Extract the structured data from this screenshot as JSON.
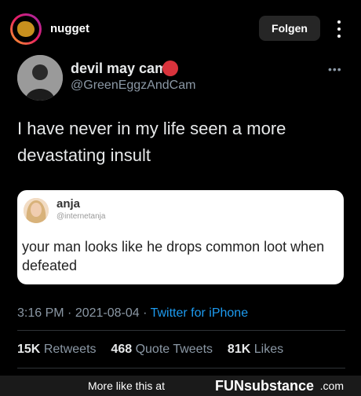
{
  "instagram": {
    "username": "nugget",
    "follow_label": "Folgen",
    "more_icon": "more-vertical-icon"
  },
  "tweet": {
    "display_name": "devil may cam",
    "name_emoji": "ogre-emoji",
    "handle": "@GreenEggzAndCam",
    "more_icon": "more-horizontal-icon",
    "text": "I have never in my life seen a more devastating insult",
    "quoted": {
      "name": "anja",
      "handle": "@internetanja",
      "text": "your man looks like he drops common loot when defeated"
    },
    "time": "3:16 PM",
    "date": "2021-08-04",
    "source": "Twitter for iPhone",
    "stats": {
      "retweets_count": "15K",
      "retweets_label": "Retweets",
      "quote_count": "468",
      "quote_label": "Quote Tweets",
      "likes_count": "81K",
      "likes_label": "Likes"
    }
  },
  "footer": {
    "text": "More like this at",
    "brand": "FUNsubstance",
    "brand_tld": ".com"
  },
  "colors": {
    "background": "#000000",
    "link_blue": "#1d9bf0",
    "muted": "#8b98a5",
    "follow_button": "#262626"
  }
}
